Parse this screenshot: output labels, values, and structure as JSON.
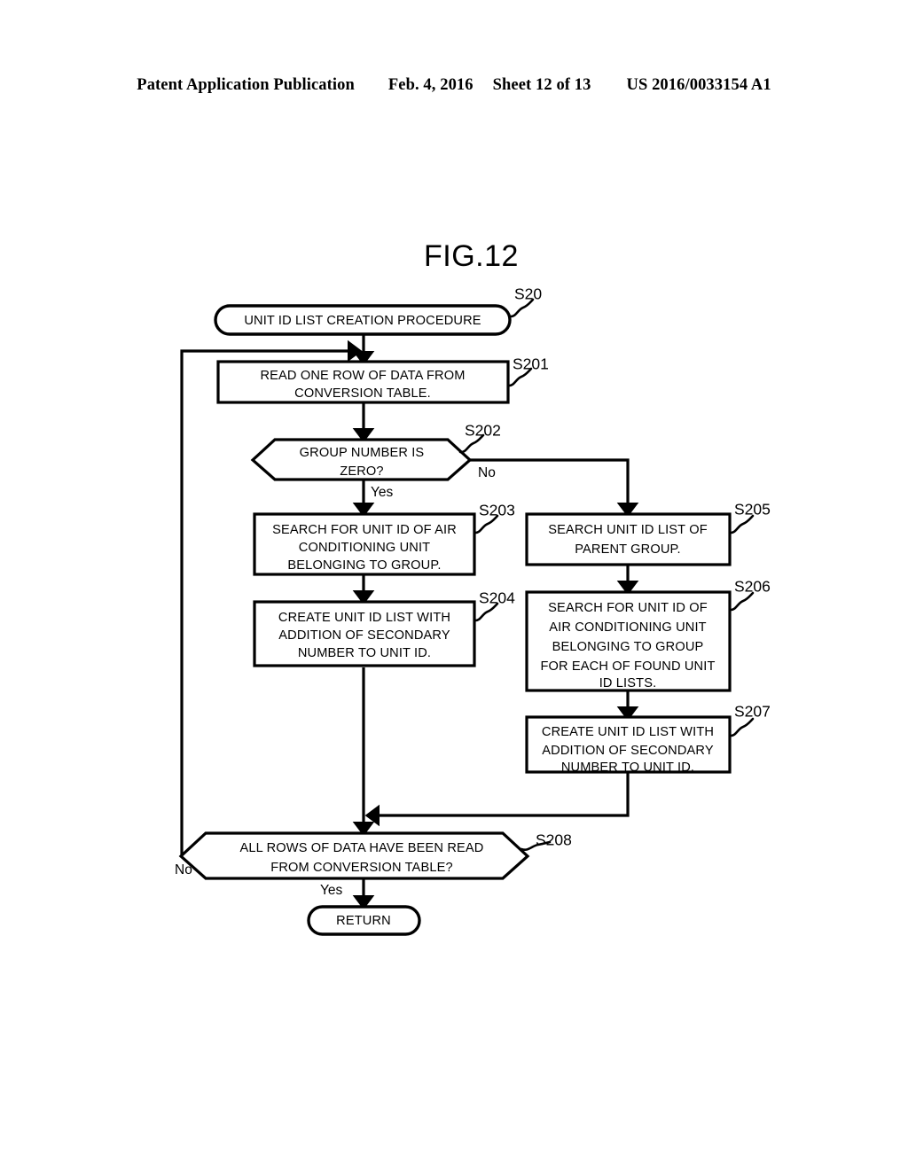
{
  "header": {
    "publication": "Patent Application Publication",
    "date": "Feb. 4, 2016",
    "sheet": "Sheet 12 of 13",
    "doc_number": "US 2016/0033154 A1"
  },
  "figure": {
    "title": "FIG.12"
  },
  "chart_data": {
    "type": "diagram",
    "diagram_type": "flowchart",
    "title": "FIG.12",
    "nodes": [
      {
        "id": "S20",
        "step": "S20",
        "shape": "terminator",
        "lines": [
          "UNIT ID LIST CREATION PROCEDURE"
        ]
      },
      {
        "id": "S201",
        "step": "S201",
        "shape": "process",
        "lines": [
          "READ ONE ROW OF DATA FROM",
          "CONVERSION TABLE."
        ]
      },
      {
        "id": "S202",
        "step": "S202",
        "shape": "decision",
        "lines": [
          "GROUP NUMBER IS",
          "ZERO?"
        ]
      },
      {
        "id": "S203",
        "step": "S203",
        "shape": "process",
        "lines": [
          "SEARCH FOR UNIT ID OF AIR",
          "CONDITIONING UNIT",
          "BELONGING TO GROUP."
        ]
      },
      {
        "id": "S204",
        "step": "S204",
        "shape": "process",
        "lines": [
          "CREATE UNIT ID LIST WITH",
          "ADDITION OF SECONDARY",
          "NUMBER TO UNIT ID."
        ]
      },
      {
        "id": "S205",
        "step": "S205",
        "shape": "process",
        "lines": [
          "SEARCH UNIT ID LIST OF",
          "PARENT GROUP."
        ]
      },
      {
        "id": "S206",
        "step": "S206",
        "shape": "process",
        "lines": [
          "SEARCH FOR UNIT ID OF",
          "AIR CONDITIONING UNIT",
          "BELONGING TO GROUP",
          "FOR EACH OF FOUND UNIT",
          "ID LISTS."
        ]
      },
      {
        "id": "S207",
        "step": "S207",
        "shape": "process",
        "lines": [
          "CREATE UNIT ID LIST WITH",
          "ADDITION OF SECONDARY",
          "NUMBER TO UNIT ID."
        ]
      },
      {
        "id": "S208",
        "step": "S208",
        "shape": "decision",
        "lines": [
          "ALL ROWS OF DATA HAVE BEEN READ",
          "FROM CONVERSION TABLE?"
        ]
      },
      {
        "id": "RETURN",
        "step": "",
        "shape": "terminator",
        "lines": [
          "RETURN"
        ]
      }
    ],
    "edges": [
      {
        "from": "S20",
        "to": "S201",
        "label": ""
      },
      {
        "from": "S201",
        "to": "S202",
        "label": ""
      },
      {
        "from": "S202",
        "to": "S203",
        "label": "Yes"
      },
      {
        "from": "S202",
        "to": "S205",
        "label": "No"
      },
      {
        "from": "S203",
        "to": "S204",
        "label": ""
      },
      {
        "from": "S204",
        "to": "S208",
        "label": ""
      },
      {
        "from": "S205",
        "to": "S206",
        "label": ""
      },
      {
        "from": "S206",
        "to": "S207",
        "label": ""
      },
      {
        "from": "S207",
        "to": "S208",
        "label": ""
      },
      {
        "from": "S208",
        "to": "RETURN",
        "label": "Yes"
      },
      {
        "from": "S208",
        "to": "S201",
        "label": "No"
      }
    ],
    "branch_labels": {
      "s202_yes": "Yes",
      "s202_no": "No",
      "s208_yes": "Yes",
      "s208_no": "No"
    }
  }
}
